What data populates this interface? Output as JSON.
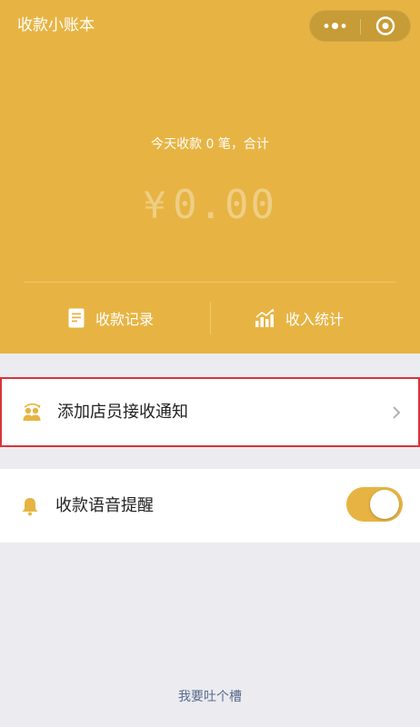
{
  "header": {
    "title": "收款小账本",
    "summary": "今天收款 0 笔，合计",
    "currency": "¥",
    "amount": "0.00",
    "bg_color": "#e7b443"
  },
  "capsule": {
    "more_icon": "more-dots-icon",
    "close_icon": "close-target-icon"
  },
  "actions": {
    "records": {
      "label": "收款记录",
      "icon": "document-icon"
    },
    "stats": {
      "label": "收入统计",
      "icon": "bar-chart-icon"
    }
  },
  "settings": {
    "add_staff": {
      "label": "添加店员接收通知",
      "icon": "staff-icon"
    },
    "voice_alert": {
      "label": "收款语音提醒",
      "icon": "bell-icon",
      "enabled": true
    }
  },
  "footer": {
    "feedback": "我要吐个槽"
  }
}
